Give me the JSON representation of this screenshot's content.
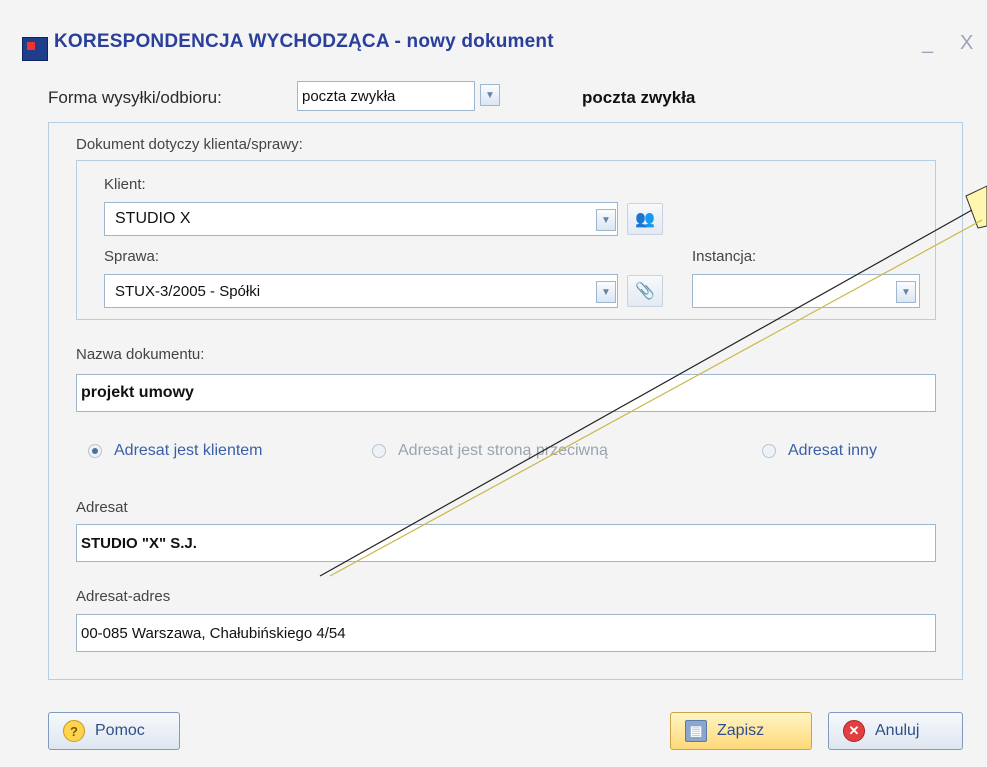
{
  "window": {
    "title": "KORESPONDENCJA WYCHODZĄCA - nowy dokument",
    "minimize": "_",
    "close": "X"
  },
  "forma": {
    "label": "Forma wysyłki/odbioru:",
    "value": "poczta zwykła",
    "display": "poczta zwykła"
  },
  "group": {
    "title": "Dokument dotyczy klienta/sprawy:",
    "klient": {
      "label": "Klient:",
      "value": "STUDIO X"
    },
    "sprawa": {
      "label": "Sprawa:",
      "value": "STUX-3/2005 - Spółki"
    },
    "instancja": {
      "label": "Instancja:",
      "value": ""
    }
  },
  "nazwa": {
    "label": "Nazwa dokumentu:",
    "value": "projekt umowy"
  },
  "radios": [
    {
      "label": "Adresat jest klientem",
      "checked": true
    },
    {
      "label": "Adresat jest stroną przeciwną",
      "checked": false
    },
    {
      "label": "Adresat inny",
      "checked": false
    }
  ],
  "adresat": {
    "label": "Adresat",
    "value": "STUDIO \"X\" S.J."
  },
  "adres": {
    "label": "Adresat-adres",
    "value": "00-085 Warszawa, Chałubińskiego 4/54"
  },
  "buttons": {
    "help": "Pomoc",
    "save": "Zapisz",
    "cancel": "Anuluj"
  },
  "colors": {
    "title": "#2a3f9a",
    "accent": "#4f6f9c",
    "save_bg": "#ffd97a",
    "cancel_icon": "#e24040"
  }
}
